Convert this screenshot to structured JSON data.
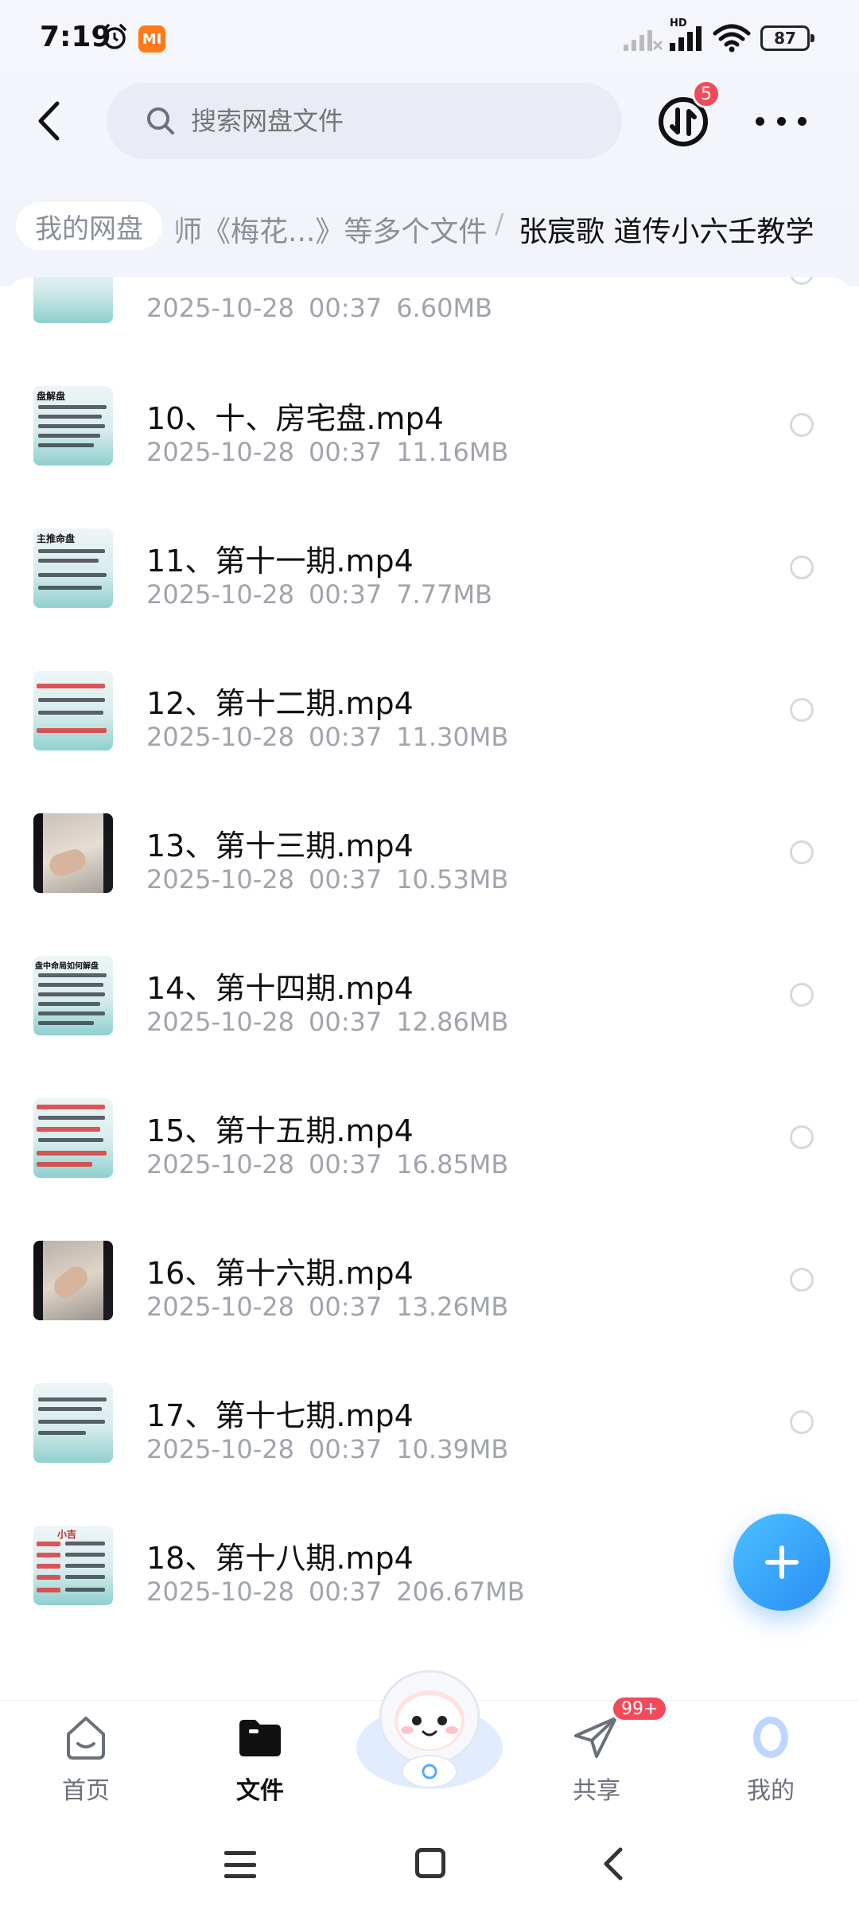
{
  "status_bar": {
    "time": "7:19",
    "mi_label": "MI",
    "hd_label": "HD",
    "battery": "87"
  },
  "header": {
    "search_placeholder": "搜索网盘文件",
    "transfer_badge": "5"
  },
  "breadcrumb": {
    "root": "我的网盘",
    "middle": "师《梅花...》等多个文件",
    "separator": "/",
    "current": "张宸歌 道传小六壬教学"
  },
  "files": [
    {
      "name": "",
      "date": "2025-10-28",
      "time": "00:37",
      "size": "6.60MB"
    },
    {
      "name": "10、十、房宅盘.mp4",
      "date": "2025-10-28",
      "time": "00:37",
      "size": "11.16MB",
      "thumb_title": "盘解盘"
    },
    {
      "name": "11、第十一期.mp4",
      "date": "2025-10-28",
      "time": "00:37",
      "size": "7.77MB",
      "thumb_title": "主推命盘"
    },
    {
      "name": "12、第十二期.mp4",
      "date": "2025-10-28",
      "time": "00:37",
      "size": "11.30MB"
    },
    {
      "name": "13、第十三期.mp4",
      "date": "2025-10-28",
      "time": "00:37",
      "size": "10.53MB"
    },
    {
      "name": "14、第十四期.mp4",
      "date": "2025-10-28",
      "time": "00:37",
      "size": "12.86MB",
      "thumb_title": "盘中命局如何解盘"
    },
    {
      "name": "15、第十五期.mp4",
      "date": "2025-10-28",
      "time": "00:37",
      "size": "16.85MB"
    },
    {
      "name": "16、第十六期.mp4",
      "date": "2025-10-28",
      "time": "00:37",
      "size": "13.26MB"
    },
    {
      "name": "17、第十七期.mp4",
      "date": "2025-10-28",
      "time": "00:37",
      "size": "10.39MB"
    },
    {
      "name": "18、第十八期.mp4",
      "date": "2025-10-28",
      "time": "00:37",
      "size": "206.67MB",
      "thumb_title": "小吉"
    }
  ],
  "bottom_nav": {
    "home": "首页",
    "files": "文件",
    "share": "共享",
    "me": "我的",
    "share_badge": "99+"
  },
  "colors": {
    "accent": "#2a8df6",
    "badge": "#f24a5a",
    "text_secondary": "#a0a4ad"
  }
}
